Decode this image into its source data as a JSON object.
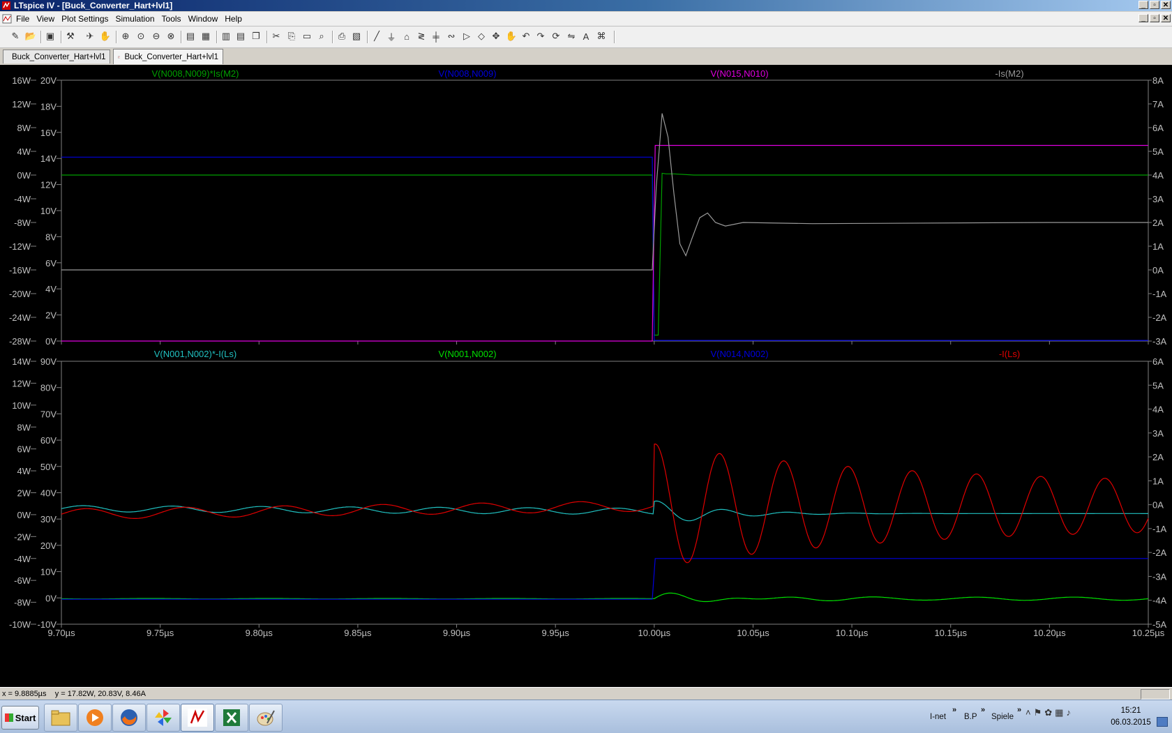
{
  "window": {
    "title": "LTspice IV - [Buck_Converter_Hart+lvl1]",
    "min_glyph": "_",
    "max_glyph": "▫",
    "close_glyph": "✕"
  },
  "menu": {
    "items": [
      "File",
      "View",
      "Plot Settings",
      "Simulation",
      "Tools",
      "Window",
      "Help"
    ]
  },
  "toolbar": {
    "icons": [
      "new-schematic-icon",
      "open-icon",
      "save-icon",
      "control-panel-icon",
      "run-icon",
      "halt-icon",
      "zoom-in-icon",
      "zoom-back-icon",
      "zoom-out-icon",
      "zoom-fit-icon",
      "autorange-icon",
      "grid-icon",
      "tile-vertical-icon",
      "tile-horizontal-icon",
      "cascade-icon",
      "cut-icon",
      "copy-icon",
      "paste-icon",
      "find-icon",
      "print-icon",
      "print-preview-icon",
      "wire-icon",
      "ground-icon",
      "label-icon",
      "resistor-icon",
      "capacitor-icon",
      "inductor-icon",
      "diode-icon",
      "component-icon",
      "move-icon",
      "drag-icon",
      "undo-icon",
      "redo-icon",
      "rotate-icon",
      "mirror-icon",
      "text-icon",
      "spice-directive-icon"
    ]
  },
  "tabs": [
    {
      "label": "Buck_Converter_Hart+lvl1",
      "icon": "schematic-icon",
      "active": false
    },
    {
      "label": "Buck_Converter_Hart+lvl1",
      "icon": "waveform-icon",
      "active": true
    }
  ],
  "colors": {
    "background": "#000000",
    "grid_frame": "#808080",
    "axis_text": "#c0c0c0",
    "green": "#00a000",
    "bright_green": "#00e000",
    "blue": "#0000e0",
    "magenta": "#e000e0",
    "gray": "#9a9a9a",
    "cyan": "#20c0c0",
    "red": "#e00000"
  },
  "chart_data": [
    {
      "type": "line",
      "pane": "top",
      "x_unit": "µs",
      "xlim": [
        9.7,
        10.25
      ],
      "left_axis_1": {
        "unit": "W",
        "ticks": [
          "16W",
          "12W",
          "8W",
          "4W",
          "0W",
          "-4W",
          "-8W",
          "-12W",
          "-16W",
          "-20W",
          "-24W",
          "-28W"
        ],
        "range": [
          -28,
          16
        ]
      },
      "left_axis_2": {
        "unit": "V",
        "ticks": [
          "20V",
          "18V",
          "16V",
          "14V",
          "12V",
          "10V",
          "8V",
          "6V",
          "4V",
          "2V",
          "0V"
        ],
        "range": [
          0,
          20
        ]
      },
      "right_axis": {
        "unit": "A",
        "ticks": [
          "8A",
          "7A",
          "6A",
          "5A",
          "4A",
          "3A",
          "2A",
          "1A",
          "0A",
          "-1A",
          "-2A",
          "-3A"
        ],
        "range": [
          -3,
          8
        ]
      },
      "series": [
        {
          "name": "V(N008,N009)*Is(M2)",
          "color": "#00a000",
          "axis": "W",
          "points": [
            [
              9.7,
              0.0
            ],
            [
              9.999,
              0.0
            ],
            [
              10.0,
              -27
            ],
            [
              10.002,
              -27
            ],
            [
              10.004,
              0.3
            ],
            [
              10.006,
              0.2
            ],
            [
              10.01,
              0.2
            ],
            [
              10.02,
              0.0
            ],
            [
              10.25,
              0.0
            ]
          ]
        },
        {
          "name": "V(N008,N009)",
          "color": "#0000e0",
          "axis": "V",
          "points": [
            [
              9.7,
              14.1
            ],
            [
              9.999,
              14.1
            ],
            [
              10.0,
              0.05
            ],
            [
              10.25,
              0.05
            ]
          ]
        },
        {
          "name": "V(N015,N010)",
          "color": "#e000e0",
          "axis": "V",
          "points": [
            [
              9.7,
              0.0
            ],
            [
              9.999,
              0.0
            ],
            [
              10.0005,
              15.0
            ],
            [
              10.25,
              15.0
            ]
          ]
        },
        {
          "name": "-Is(M2)",
          "color": "#9a9a9a",
          "axis": "A",
          "points": [
            [
              9.7,
              0.0
            ],
            [
              9.999,
              0.0
            ],
            [
              10.001,
              3.5
            ],
            [
              10.004,
              6.6
            ],
            [
              10.007,
              5.6
            ],
            [
              10.01,
              3.2
            ],
            [
              10.013,
              1.1
            ],
            [
              10.016,
              0.6
            ],
            [
              10.019,
              1.3
            ],
            [
              10.023,
              2.2
            ],
            [
              10.027,
              2.4
            ],
            [
              10.031,
              2.0
            ],
            [
              10.036,
              1.85
            ],
            [
              10.045,
              2.0
            ],
            [
              10.08,
              1.95
            ],
            [
              10.2,
              2.0
            ],
            [
              10.25,
              2.0
            ]
          ]
        }
      ]
    },
    {
      "type": "line",
      "pane": "bottom",
      "x_unit": "µs",
      "xlim": [
        9.7,
        10.25
      ],
      "x_ticks": [
        "9.70µs",
        "9.75µs",
        "9.80µs",
        "9.85µs",
        "9.90µs",
        "9.95µs",
        "10.00µs",
        "10.05µs",
        "10.10µs",
        "10.15µs",
        "10.20µs",
        "10.25µs"
      ],
      "left_axis_1": {
        "unit": "W",
        "ticks": [
          "14W",
          "12W",
          "10W",
          "8W",
          "6W",
          "4W",
          "2W",
          "0W",
          "-2W",
          "-4W",
          "-6W",
          "-8W",
          "-10W"
        ],
        "range": [
          -10,
          14
        ]
      },
      "left_axis_2": {
        "unit": "V",
        "ticks": [
          "90V",
          "80V",
          "70V",
          "60V",
          "50V",
          "40V",
          "30V",
          "20V",
          "10V",
          "0V",
          "-10V"
        ],
        "range": [
          -10,
          90
        ]
      },
      "right_axis": {
        "unit": "A",
        "ticks": [
          "6A",
          "5A",
          "4A",
          "3A",
          "2A",
          "1A",
          "0A",
          "-1A",
          "-2A",
          "-3A",
          "-4A",
          "-5A"
        ],
        "range": [
          -5,
          6
        ]
      },
      "series": [
        {
          "name": "V(N001,N002)*-I(Ls)",
          "color": "#20c0c0",
          "axis": "W",
          "kind": "cyan_wave"
        },
        {
          "name": "V(N001,N002)",
          "color": "#00e000",
          "axis": "V",
          "kind": "green_wave"
        },
        {
          "name": "V(N014,N002)",
          "color": "#0000e0",
          "axis": "V",
          "kind": "blue_step",
          "points": [
            [
              9.7,
              -0.5
            ],
            [
              9.999,
              -0.5
            ],
            [
              10.0005,
              15.0
            ],
            [
              10.25,
              15.0
            ]
          ]
        },
        {
          "name": "-I(Ls)",
          "color": "#e00000",
          "axis": "A",
          "kind": "red_wave"
        }
      ]
    }
  ],
  "status": {
    "text": "x = 9.8885µs    y = 17.82W, 20.83V, 8.46A"
  },
  "taskbar": {
    "start_label": "Start",
    "apps": [
      "explorer-icon",
      "media-player-icon",
      "firefox-icon",
      "pinwheel-app-icon",
      "ltspice-icon",
      "excel-icon",
      "paint-icon"
    ],
    "toolbars": [
      "I-net",
      "B.P",
      "Spiele"
    ],
    "chevron": "»",
    "tray_up": "˄",
    "time": "15:21",
    "date": "06.03.2015"
  }
}
